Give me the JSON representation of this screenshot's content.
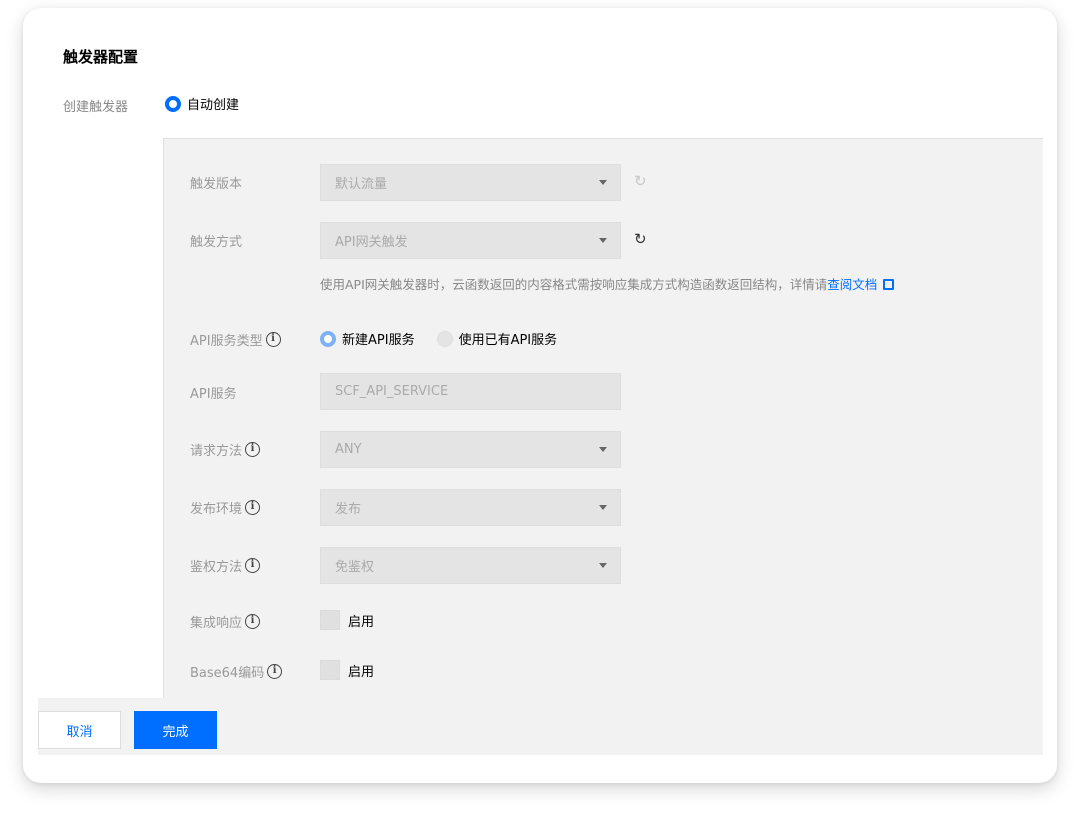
{
  "section": {
    "title": "触发器配置",
    "create_trigger_label": "创建触发器",
    "create_trigger_option": "自动创建"
  },
  "trigger_version": {
    "label": "触发版本",
    "value": "默认流量",
    "refresh_icon": "refresh-icon"
  },
  "trigger_method": {
    "label": "触发方式",
    "value": "API网关触发",
    "refresh_icon": "refresh-icon",
    "hint_text": "使用API网关触发器时，云函数返回的内容格式需按响应集成方式构造函数返回结构，详情请",
    "hint_link": "查阅文档",
    "hint_link_icon": "external-link-icon"
  },
  "api_service_type": {
    "label": "API服务类型",
    "options": [
      {
        "label": "新建API服务",
        "selected": true
      },
      {
        "label": "使用已有API服务",
        "selected": false
      }
    ]
  },
  "api_service": {
    "label": "API服务",
    "value": "SCF_API_SERVICE"
  },
  "request_method": {
    "label": "请求方法",
    "value": "ANY"
  },
  "publish_env": {
    "label": "发布环境",
    "value": "发布"
  },
  "auth_method": {
    "label": "鉴权方法",
    "value": "免鉴权"
  },
  "integration_response": {
    "label": "集成响应",
    "checkbox_label": "启用",
    "checked": false
  },
  "base64_encoding": {
    "label": "Base64编码",
    "checkbox_label": "启用",
    "checked": false
  },
  "footer": {
    "cancel_label": "取消",
    "done_label": "完成"
  },
  "colors": {
    "accent": "#006eff",
    "panel_bg": "#f2f2f2",
    "field_bg": "#e4e4e4",
    "label_gray": "#999999"
  }
}
